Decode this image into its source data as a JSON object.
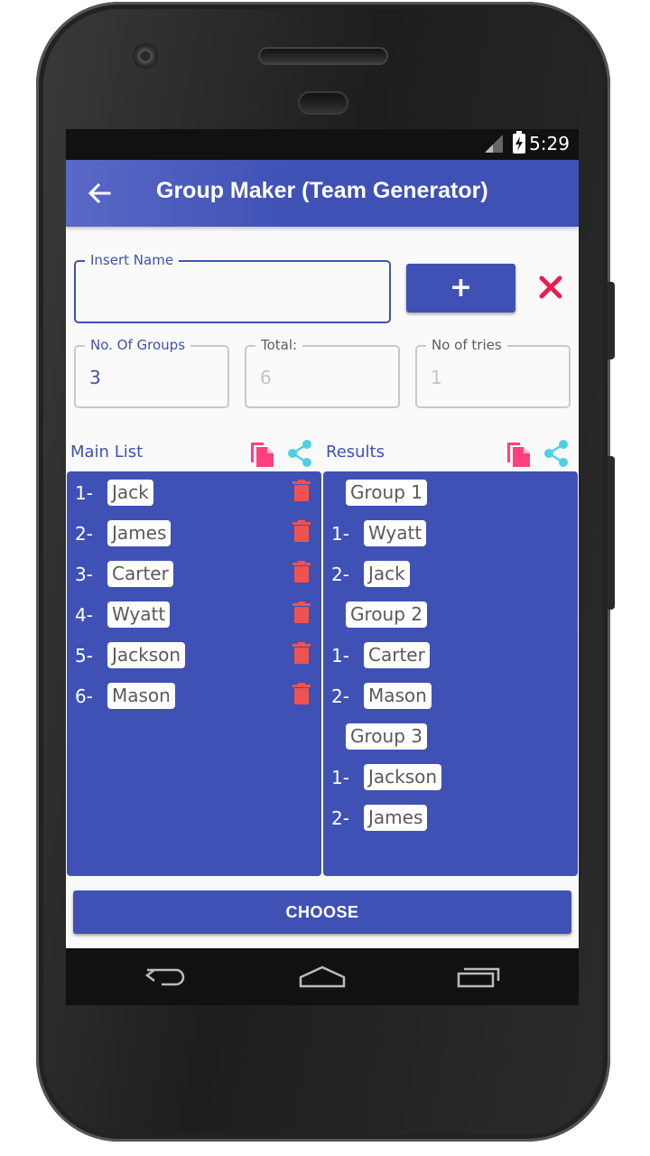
{
  "status_bar": {
    "time": "5:29"
  },
  "app_bar": {
    "title": "Group Maker (Team Generator)"
  },
  "name_input": {
    "label": "Insert Name",
    "value": ""
  },
  "add_button": {
    "label": "+"
  },
  "groups_field": {
    "label": "No. Of Groups",
    "value": "3"
  },
  "total_field": {
    "label": "Total:",
    "value": "6"
  },
  "tries_field": {
    "label": "No of tries",
    "value": "1"
  },
  "main_list": {
    "title": "Main List",
    "items": [
      {
        "num": "1-",
        "name": "Jack"
      },
      {
        "num": "2-",
        "name": "James"
      },
      {
        "num": "3-",
        "name": "Carter"
      },
      {
        "num": "4-",
        "name": "Wyatt"
      },
      {
        "num": "5-",
        "name": "Jackson"
      },
      {
        "num": "6-",
        "name": "Mason"
      }
    ]
  },
  "results": {
    "title": "Results",
    "groups": [
      {
        "label": "Group 1",
        "members": [
          {
            "num": "1-",
            "name": "Wyatt"
          },
          {
            "num": "2-",
            "name": "Jack"
          }
        ]
      },
      {
        "label": "Group 2",
        "members": [
          {
            "num": "1-",
            "name": "Carter"
          },
          {
            "num": "2-",
            "name": "Mason"
          }
        ]
      },
      {
        "label": "Group 3",
        "members": [
          {
            "num": "1-",
            "name": "Jackson"
          },
          {
            "num": "2-",
            "name": "James"
          }
        ]
      }
    ]
  },
  "choose_button": {
    "label": "CHOOSE"
  },
  "colors": {
    "primary": "#3f51b5",
    "delete": "#ef5350",
    "copy": "#ff4081",
    "share": "#4dd0e1"
  }
}
